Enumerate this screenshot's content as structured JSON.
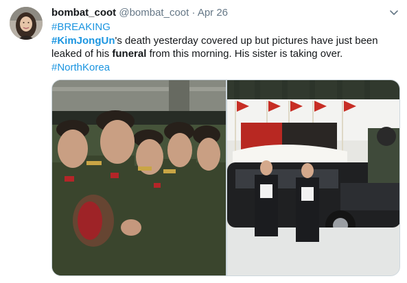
{
  "tweet": {
    "display_name": "bombat_coot",
    "handle": "@bombat_coot",
    "separator": "·",
    "date": "Apr 26",
    "hashtag_breaking": "#BREAKING",
    "mention_tag": "#KimJongUn",
    "text_part1": "'s death yesterday covered up but pictures have just been leaked of his ",
    "text_bold": "funeral",
    "text_part2": " from this morning. His sister is taking over.",
    "hashtag_country": "#NorthKorea"
  },
  "icons": {
    "menu": "chevron-down-icon"
  },
  "colors": {
    "link": "#1b95e0",
    "text": "#14171a",
    "muted": "#657786"
  }
}
